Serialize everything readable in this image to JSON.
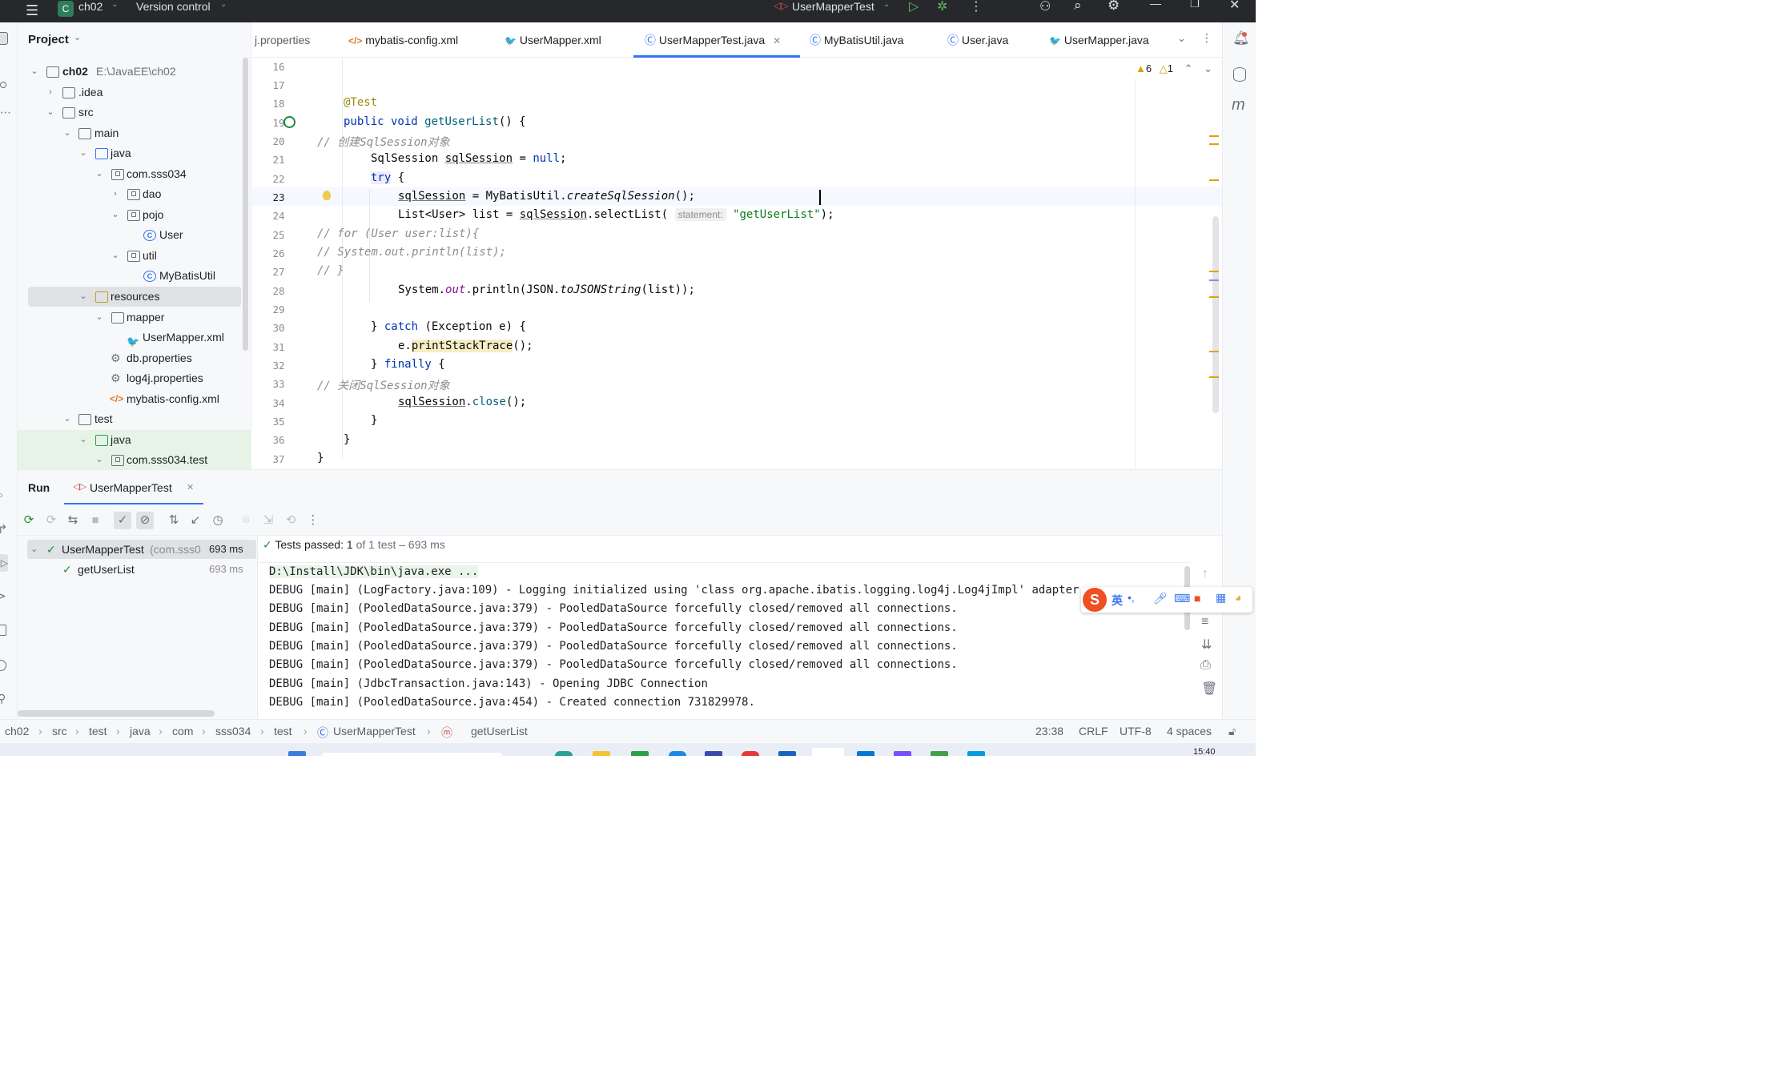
{
  "titlebar": {
    "project_badge": "C",
    "project": "ch02",
    "vcs": "Version control",
    "run_config": "UserMapperTest"
  },
  "project_panel": {
    "title": "Project",
    "root_name": "ch02",
    "root_path": "E:\\JavaEE\\ch02",
    "items": [
      {
        "label": "ch02"
      },
      {
        "label": ".idea"
      },
      {
        "label": "src"
      },
      {
        "label": "main"
      },
      {
        "label": "java"
      },
      {
        "label": "com.sss034"
      },
      {
        "label": "dao"
      },
      {
        "label": "pojo"
      },
      {
        "label": "User"
      },
      {
        "label": "util"
      },
      {
        "label": "MyBatisUtil"
      },
      {
        "label": "resources"
      },
      {
        "label": "mapper"
      },
      {
        "label": "UserMapper.xml"
      },
      {
        "label": "db.properties"
      },
      {
        "label": "log4j.properties"
      },
      {
        "label": "mybatis-config.xml"
      },
      {
        "label": "test"
      },
      {
        "label": "java"
      },
      {
        "label": "com.sss034.test"
      }
    ]
  },
  "tabs": [
    {
      "label": "j.properties"
    },
    {
      "label": "mybatis-config.xml"
    },
    {
      "label": "UserMapper.xml"
    },
    {
      "label": "UserMapperTest.java",
      "active": true
    },
    {
      "label": "MyBatisUtil.java"
    },
    {
      "label": "User.java"
    },
    {
      "label": "UserMapper.java"
    }
  ],
  "inspections": {
    "warnings": "6",
    "weak_warnings": "1"
  },
  "editor": {
    "line_numbers": [
      "16",
      "17",
      "18",
      "19",
      "20",
      "21",
      "22",
      "23",
      "24",
      "25",
      "26",
      "27",
      "28",
      "29",
      "30",
      "31",
      "32",
      "33",
      "34",
      "35",
      "36",
      "37"
    ],
    "param_hint": "statement:"
  },
  "run": {
    "tab_title": "Run",
    "config_tab": "UserMapperTest",
    "root_test": "UserMapperTest",
    "root_test_pkg": "(com.sss0",
    "root_time": "693 ms",
    "child_test": "getUserList",
    "child_time": "693 ms",
    "summary_label": "Tests passed:",
    "summary_count": "1",
    "summary_rest": "of 1 test – 693 ms",
    "console": [
      "D:\\Install\\JDK\\bin\\java.exe ...",
      "DEBUG [main] (LogFactory.java:109) - Logging initialized using 'class org.apache.ibatis.logging.log4j.Log4jImpl' adapter.",
      "DEBUG [main] (PooledDataSource.java:379) - PooledDataSource forcefully closed/removed all connections.",
      "DEBUG [main] (PooledDataSource.java:379) - PooledDataSource forcefully closed/removed all connections.",
      "DEBUG [main] (PooledDataSource.java:379) - PooledDataSource forcefully closed/removed all connections.",
      "DEBUG [main] (PooledDataSource.java:379) - PooledDataSource forcefully closed/removed all connections.",
      "DEBUG [main] (JdbcTransaction.java:143) - Opening JDBC Connection",
      "DEBUG [main] (PooledDataSource.java:454) - Created connection 731829978."
    ]
  },
  "statusbar": {
    "breadcrumbs": [
      "ch02",
      "src",
      "test",
      "java",
      "com",
      "sss034",
      "test",
      "UserMapperTest",
      "getUserList"
    ],
    "position": "23:38",
    "line_sep": "CRLF",
    "encoding": "UTF-8",
    "indent": "4 spaces"
  },
  "ime": {
    "mode": "英",
    "punct": "•,"
  },
  "taskbar": {
    "time": "15:40"
  },
  "colors": {
    "accent": "#3574f0",
    "success": "#208a3c",
    "warning": "#e0a200",
    "titlebar": "#27282c"
  }
}
